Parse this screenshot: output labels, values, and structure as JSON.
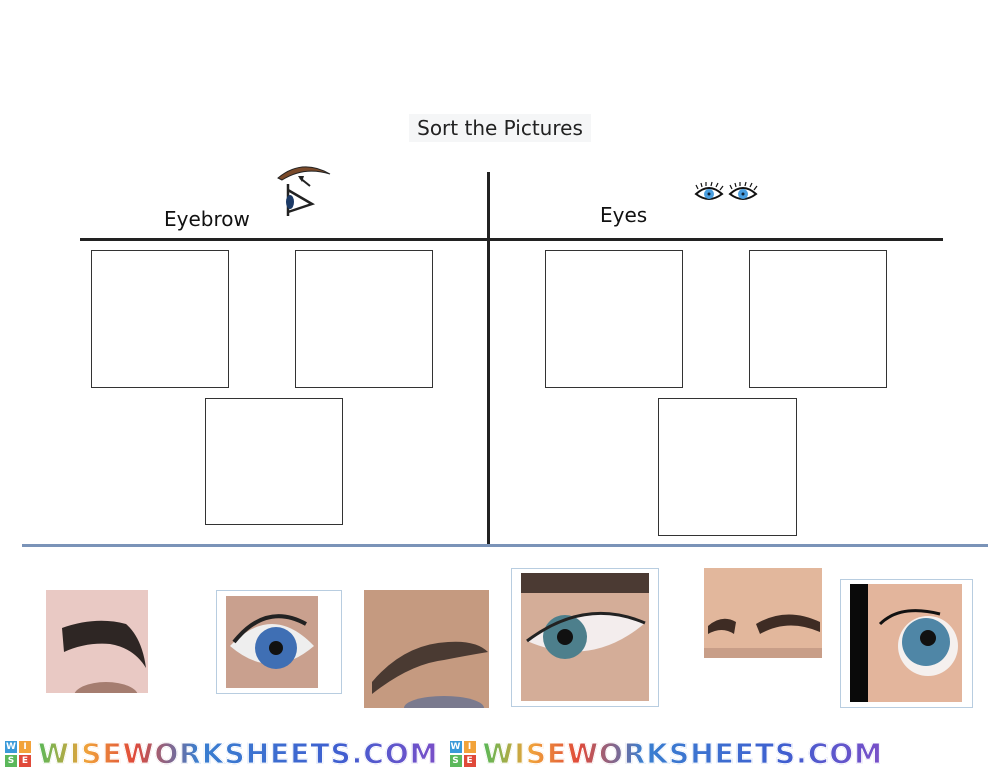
{
  "worksheet": {
    "title": "Sort the Pictures",
    "columns": [
      {
        "label": "Eyebrow",
        "icon": "eyebrow-eye-icon",
        "drop_targets": 3
      },
      {
        "label": "Eyes",
        "icon": "eyes-icon",
        "drop_targets": 3
      }
    ],
    "pictures": [
      {
        "id": "pic-1",
        "subject": "eyebrow"
      },
      {
        "id": "pic-2",
        "subject": "blue eye"
      },
      {
        "id": "pic-3",
        "subject": "eyebrow"
      },
      {
        "id": "pic-4",
        "subject": "eye"
      },
      {
        "id": "pic-5",
        "subject": "eyebrows"
      },
      {
        "id": "pic-6",
        "subject": "eye"
      }
    ]
  },
  "footer": {
    "brand": "WISEWORKSHEETS.COM",
    "logo_letters": [
      "W",
      "I",
      "S",
      "E"
    ],
    "colors": {
      "w": "#3a9ad9",
      "i": "#f2a33a",
      "s": "#5bb85b",
      "e": "#e04a3a"
    }
  }
}
